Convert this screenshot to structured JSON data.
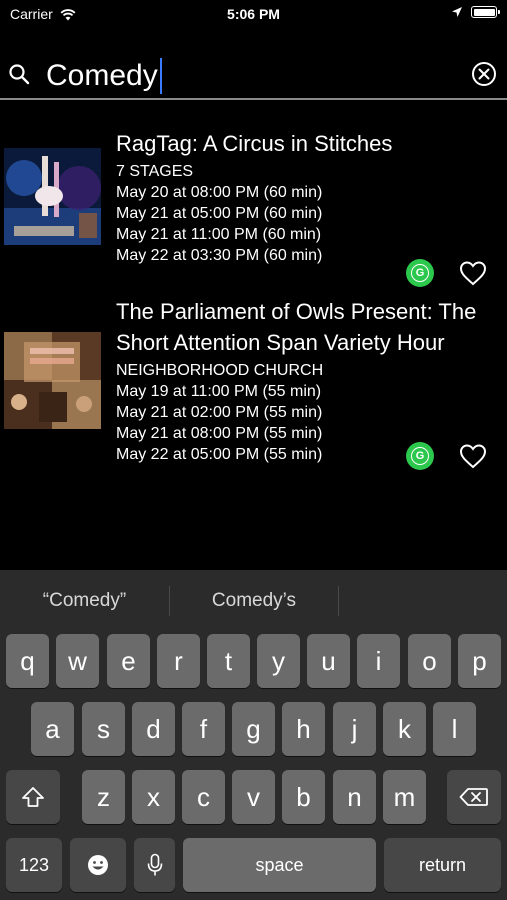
{
  "status_bar": {
    "carrier": "Carrier",
    "time": "5:06 PM"
  },
  "search": {
    "query": "Comedy"
  },
  "results": [
    {
      "title_lines": [
        "RagTag: A Circus in Stitches"
      ],
      "venue": "7 STAGES",
      "times": [
        "May 20 at 08:00 PM (60 min)",
        "May 21 at 05:00 PM (60 min)",
        "May 21 at 11:00 PM (60 min)",
        "May 22 at 03:30 PM (60 min)"
      ],
      "badge": "G"
    },
    {
      "title_lines": [
        "The Parliament of Owls Present: The",
        "Short Attention Span Variety Hour"
      ],
      "venue": "NEIGHBORHOOD CHURCH",
      "times": [
        "May 19 at 11:00 PM (55 min)",
        "May 21 at 02:00 PM (55 min)",
        "May 21 at 08:00 PM (55 min)",
        "May 22 at 05:00 PM (55 min)"
      ],
      "badge": "G"
    }
  ],
  "keyboard": {
    "suggestions": [
      "“Comedy”",
      "Comedy’s"
    ],
    "row1": [
      "q",
      "w",
      "e",
      "r",
      "t",
      "y",
      "u",
      "i",
      "o",
      "p"
    ],
    "row2": [
      "a",
      "s",
      "d",
      "f",
      "g",
      "h",
      "j",
      "k",
      "l"
    ],
    "row3": [
      "z",
      "x",
      "c",
      "v",
      "b",
      "n",
      "m"
    ],
    "numbers_label": "123",
    "space_label": "space",
    "return_label": "return"
  },
  "colors": {
    "badge_green": "#2cc84d",
    "caret_blue": "#3a7bff"
  }
}
